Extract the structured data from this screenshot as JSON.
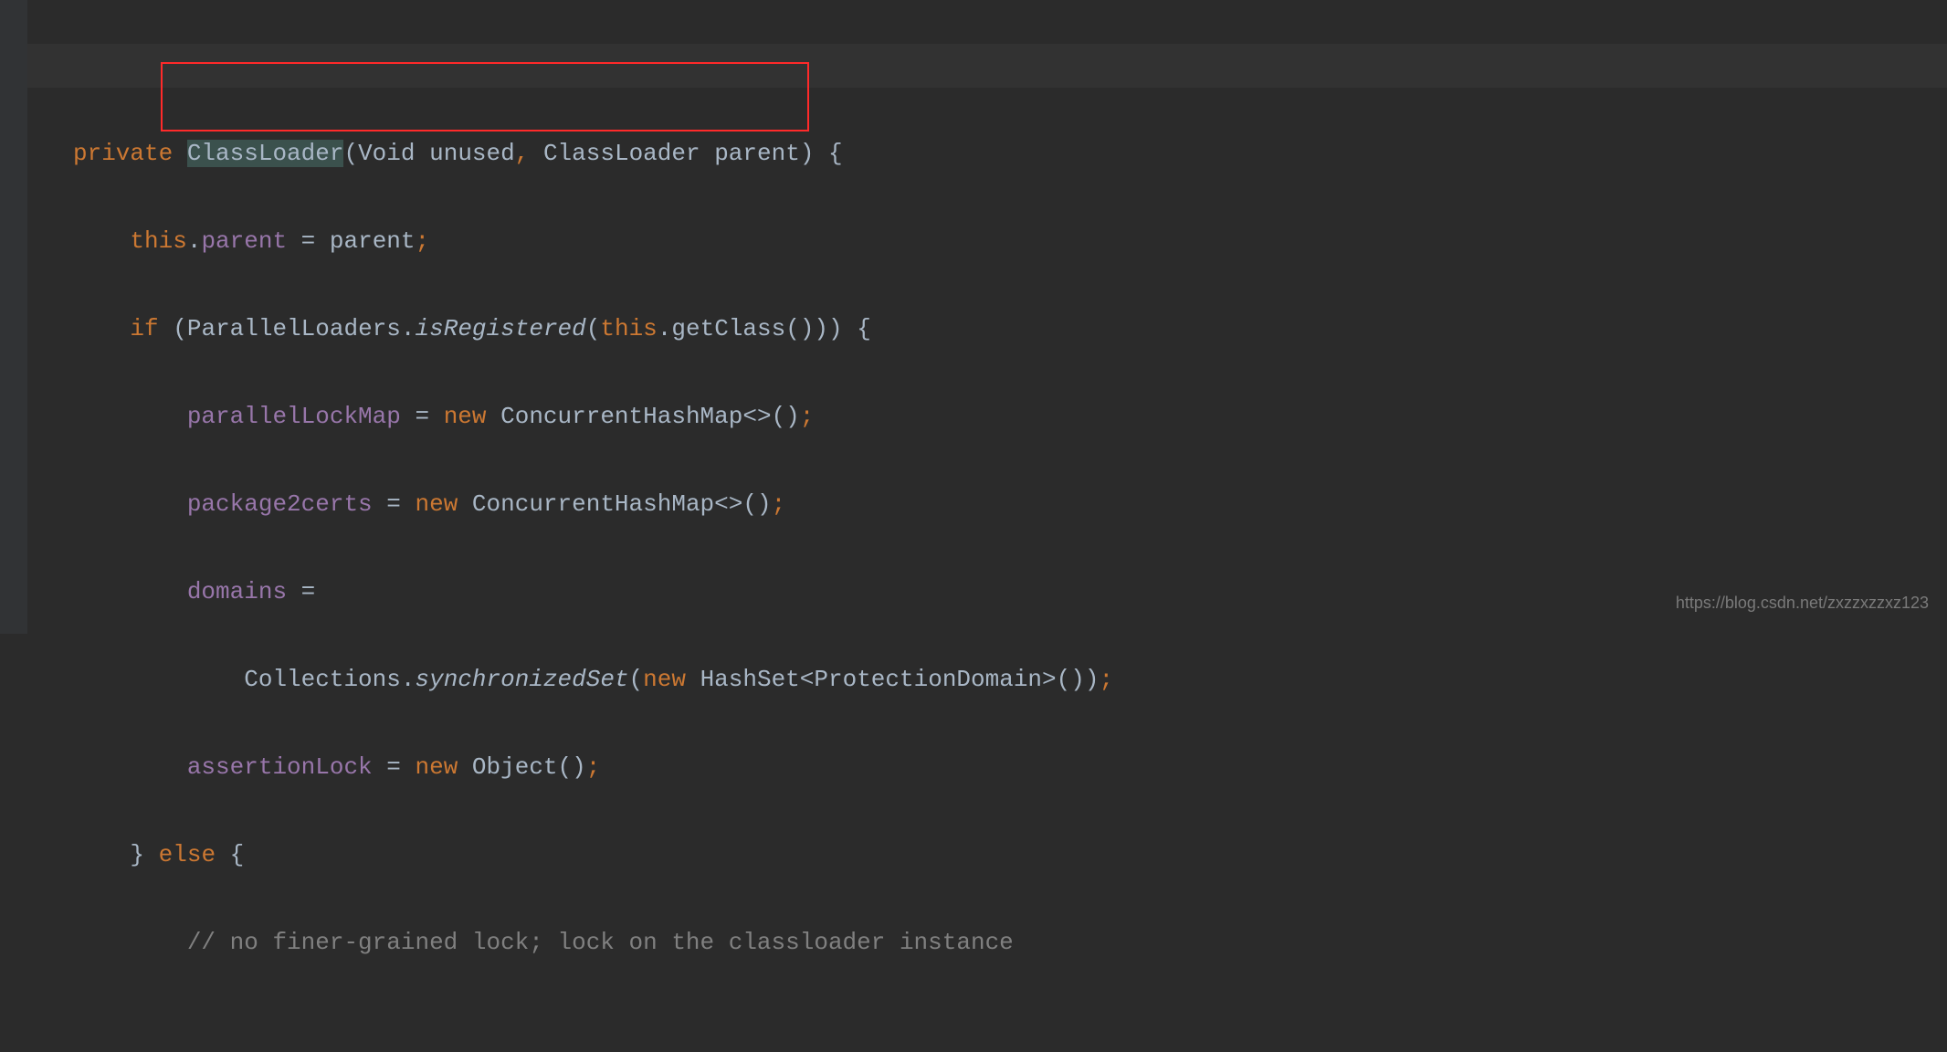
{
  "code": {
    "line1": {
      "kw_private": "private",
      "type_classloader": "ClassLoader",
      "param_void": "Void",
      "param_unused": "unused",
      "comma": ",",
      "type_classloader2": "ClassLoader",
      "param_parent": "parent",
      "brace": ") {"
    },
    "line2": {
      "kw_this": "this",
      "dot": ".",
      "field_parent": "parent",
      "eq": " = ",
      "var_parent": "parent",
      "semi": ";"
    },
    "line3": {
      "kw_if": "if",
      "open": " (",
      "type_parallel": "ParallelLoaders",
      "dot": ".",
      "meth_isreg": "isRegistered",
      "open2": "(",
      "kw_this": "this",
      "dot2": ".",
      "meth_getclass": "getClass",
      "close": "())) {"
    },
    "line4": {
      "field_plm": "parallelLockMap",
      "eq": " = ",
      "kw_new": "new",
      "sp": " ",
      "type_chm": "ConcurrentHashMap",
      "diamond": "<>();"
    },
    "line5": {
      "field_p2c": "package2certs",
      "eq": " = ",
      "kw_new": "new",
      "sp": " ",
      "type_chm": "ConcurrentHashMap",
      "diamond": "<>();"
    },
    "line6": {
      "field_domains": "domains",
      "eq": " ="
    },
    "line7": {
      "type_col": "Collections",
      "dot": ".",
      "meth_sync": "synchronizedSet",
      "open": "(",
      "kw_new": "new",
      "sp": " ",
      "type_hs": "HashSet",
      "lt": "<",
      "type_pd": "ProtectionDomain",
      "gt": ">",
      "close": "());"
    },
    "line8": {
      "field_al": "assertionLock",
      "eq": " = ",
      "kw_new": "new",
      "sp": " ",
      "type_obj": "Object",
      "close": "();"
    },
    "line9": {
      "close": "} ",
      "kw_else": "else",
      "open": " {"
    },
    "line10": {
      "comment": "// no finer-grained lock; lock on the classloader instance"
    }
  },
  "watermark": "https://blog.csdn.net/zxzzxzzxz123"
}
